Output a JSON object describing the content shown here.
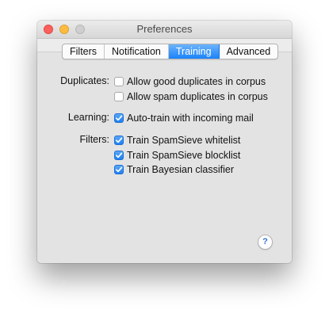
{
  "window": {
    "title": "Preferences"
  },
  "tabs": [
    {
      "label": "Filters",
      "selected": false
    },
    {
      "label": "Notification",
      "selected": false
    },
    {
      "label": "Training",
      "selected": true
    },
    {
      "label": "Advanced",
      "selected": false
    }
  ],
  "sections": {
    "duplicates": {
      "label": "Duplicates:",
      "options": [
        {
          "label": "Allow good duplicates in corpus",
          "checked": false
        },
        {
          "label": "Allow spam duplicates in corpus",
          "checked": false
        }
      ]
    },
    "learning": {
      "label": "Learning:",
      "options": [
        {
          "label": "Auto-train with incoming mail",
          "checked": true
        }
      ]
    },
    "filters": {
      "label": "Filters:",
      "options": [
        {
          "label": "Train SpamSieve whitelist",
          "checked": true
        },
        {
          "label": "Train SpamSieve blocklist",
          "checked": true
        },
        {
          "label": "Train Bayesian classifier",
          "checked": true
        }
      ]
    }
  },
  "help": {
    "label": "?",
    "icon": "help-icon"
  },
  "colors": {
    "accent": "#1a82fb",
    "close": "#fc605c",
    "minimize": "#fdbc40",
    "zoom_disabled": "#cfcfcf"
  }
}
